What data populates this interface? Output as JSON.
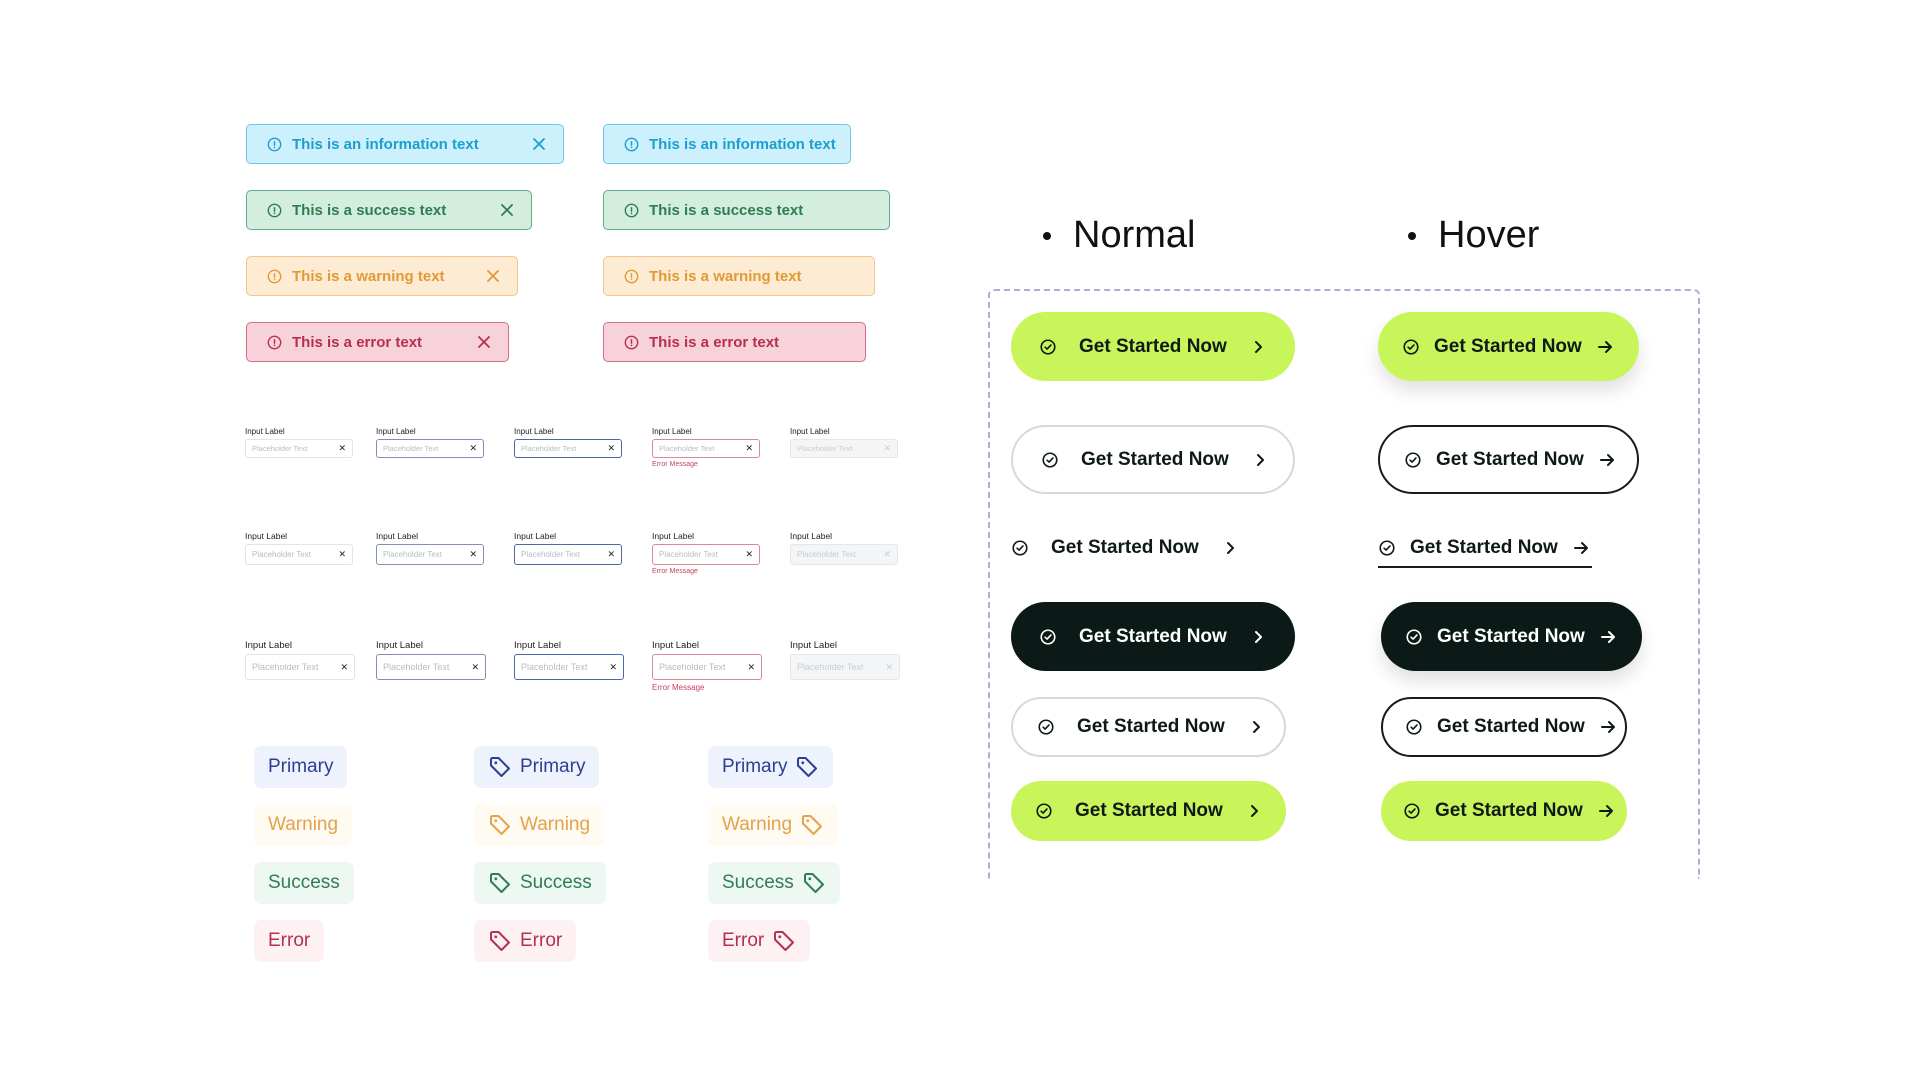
{
  "alerts": {
    "dismissible": [
      {
        "type": "info",
        "text": "This is an information text"
      },
      {
        "type": "success",
        "text": "This is a success text"
      },
      {
        "type": "warning",
        "text": "This is a warning text"
      },
      {
        "type": "error",
        "text": "This is a error text"
      }
    ],
    "static": [
      {
        "type": "info",
        "text": "This is an information text"
      },
      {
        "type": "success",
        "text": "This is a success text"
      },
      {
        "type": "warning",
        "text": "This is a warning text"
      },
      {
        "type": "error",
        "text": "This is a error text"
      }
    ]
  },
  "inputs": {
    "label": "Input Label",
    "placeholder": "Placeholder Text",
    "error_message": "Error Message",
    "states": [
      "default",
      "hover",
      "focus",
      "error",
      "disabled"
    ],
    "sizes": [
      "small",
      "medium",
      "large"
    ]
  },
  "tags": {
    "items": [
      "Primary",
      "Warning",
      "Success",
      "Error"
    ],
    "variants": [
      "no-icon",
      "icon-left",
      "icon-right"
    ]
  },
  "buttons": {
    "headings": {
      "normal": "Normal",
      "hover": "Hover"
    },
    "label": "Get Started Now",
    "variants": [
      "lime-filled",
      "outline",
      "text-link",
      "dark-filled",
      "outline-small",
      "lime-small"
    ]
  },
  "colors": {
    "lime": "#c8f55a",
    "dark": "#0b1a17",
    "info": "#1c9ecf",
    "success": "#2e7d52",
    "warning": "#e09a36",
    "error": "#b5304e",
    "primary": "#2c3f92"
  }
}
